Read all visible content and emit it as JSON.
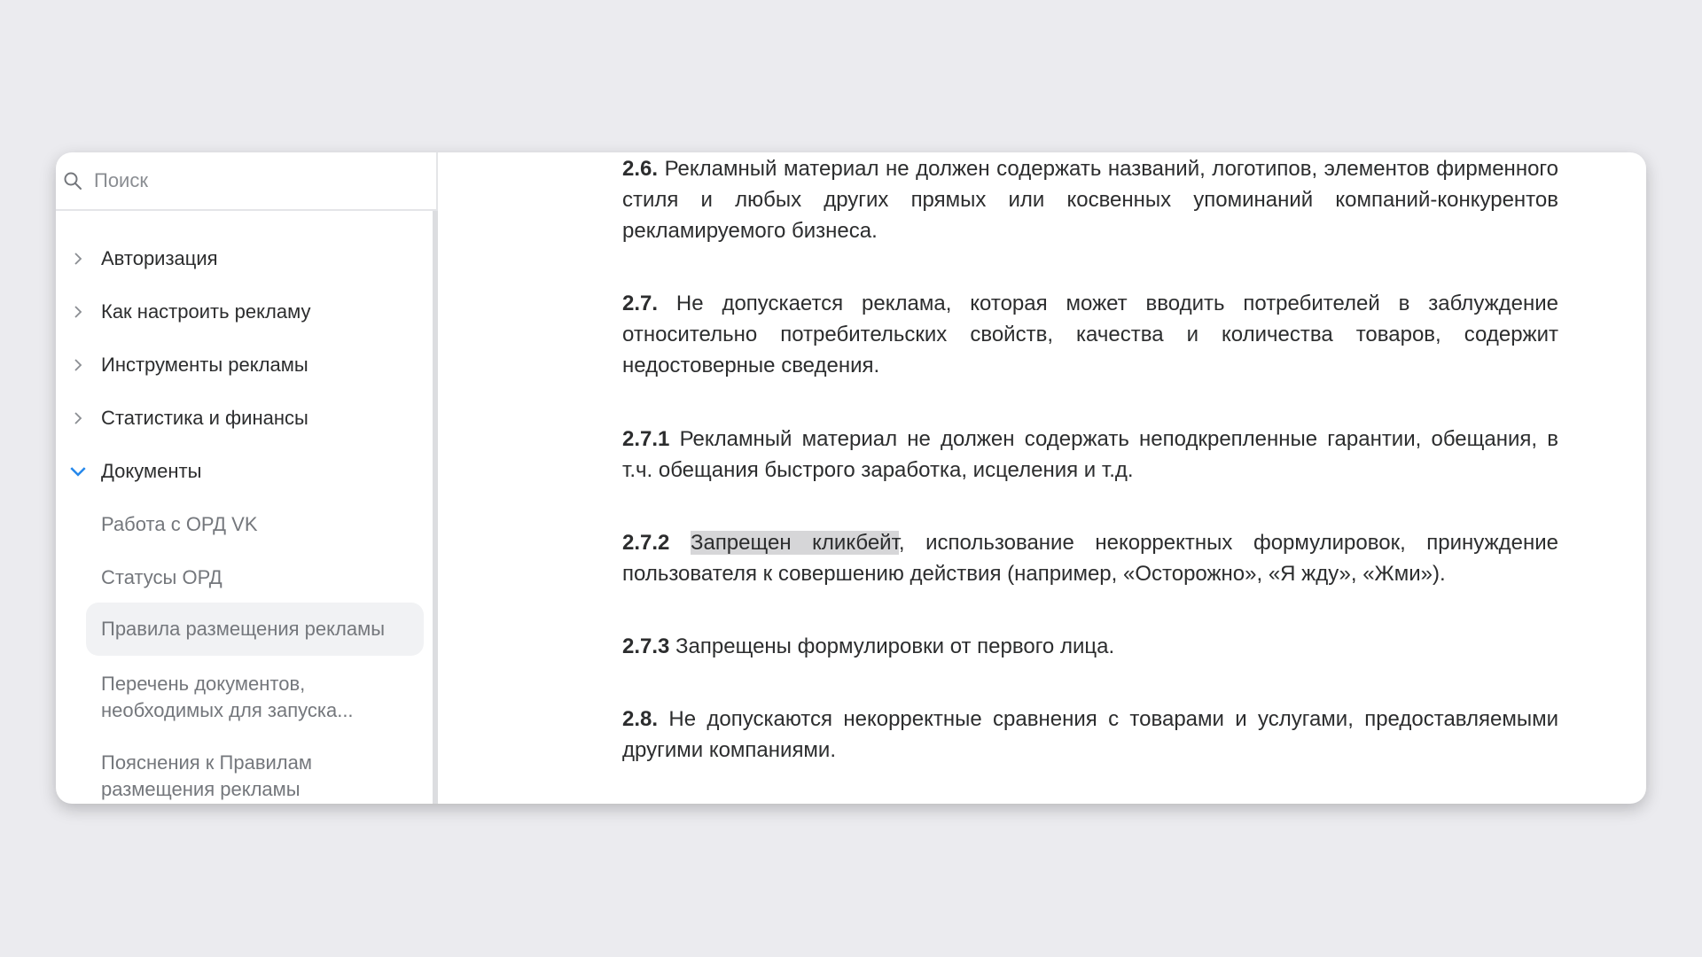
{
  "search": {
    "placeholder": "Поиск"
  },
  "nav": {
    "items": [
      {
        "label": "Авторизация"
      },
      {
        "label": "Как настроить рекламу"
      },
      {
        "label": "Инструменты рекламы"
      },
      {
        "label": "Статистика и финансы"
      },
      {
        "label": "Документы"
      }
    ],
    "sub_items": [
      {
        "label": "Работа с ОРД VK"
      },
      {
        "label": "Статусы ОРД"
      },
      {
        "label": "Правила размещения рекламы"
      },
      {
        "label": "Перечень документов, необходимых для запуска..."
      },
      {
        "label": "Пояснения к Правилам размещения рекламы"
      }
    ]
  },
  "content": {
    "p1": {
      "num": "2.6.",
      "text": " Рекламный материал не должен содержать названий, логотипов, элементов фирменного стиля и любых других прямых или косвенных упоминаний компаний-конкурентов рекламируемого бизнеса."
    },
    "p2": {
      "num": "2.7.",
      "text": " Не допускается реклама, которая может вводить потребителей в заблуждение относительно потребительских свойств, качества и количества товаров, содержит недостоверные сведения."
    },
    "p3": {
      "num": "2.7.1",
      "text": " Рекламный материал не должен содержать неподкрепленные гарантии, обещания, в т.ч. обещания быстрого заработка, исцеления и т.д."
    },
    "p4": {
      "num": "2.7.2",
      "highlight": "Запрещен кликбейт",
      "text": ", использование некорректных формулировок, принуждение пользователя к совершению действия (например, «Осторожно», «Я жду», «Жми»)."
    },
    "p5": {
      "num": "2.7.3",
      "text": " Запрещены формулировки от первого лица."
    },
    "p6": {
      "num": "2.8.",
      "text": " Не допускаются некорректные сравнения с товарами и услугами, предоставляемыми другими компаниями."
    }
  }
}
